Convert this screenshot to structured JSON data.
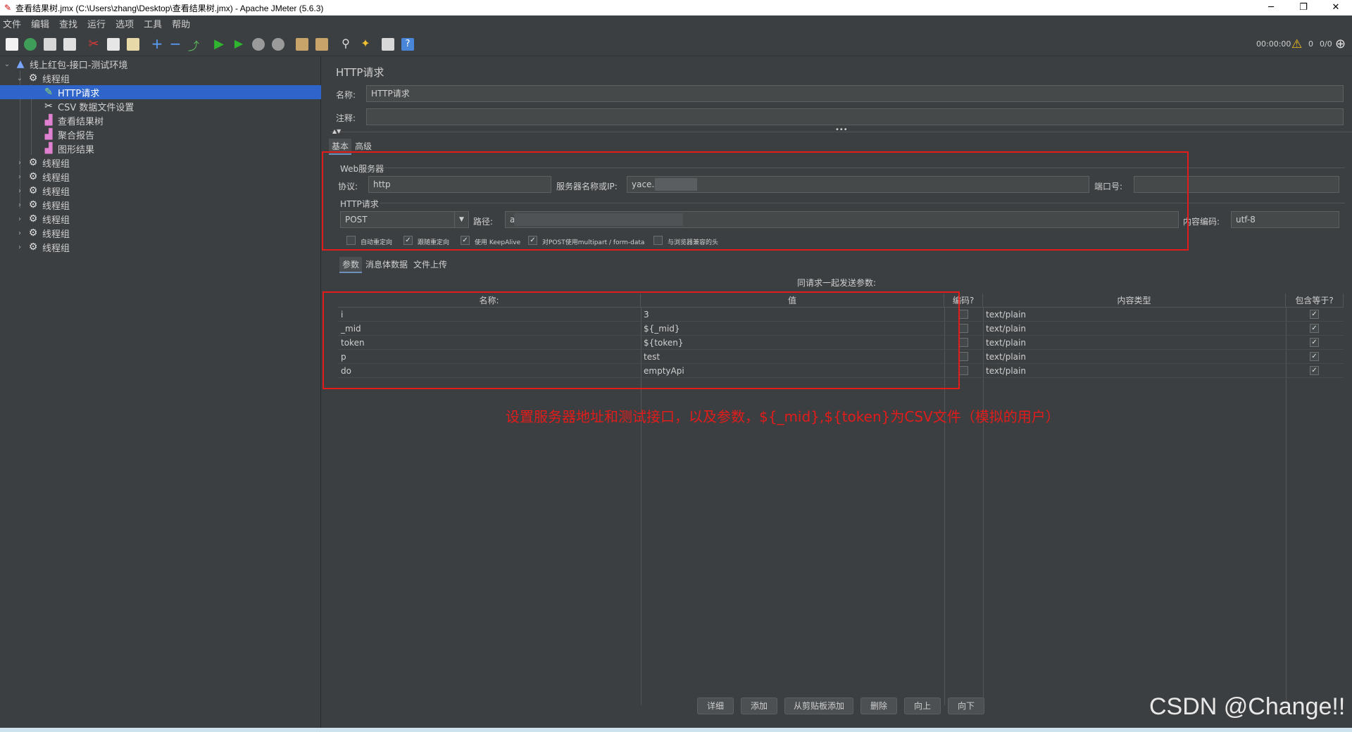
{
  "window": {
    "title": "查看结果树.jmx (C:\\Users\\zhang\\Desktop\\查看结果树.jmx) - Apache JMeter (5.6.3)",
    "minimize": "─",
    "restore": "❐",
    "close": "✕"
  },
  "menu": [
    "文件",
    "编辑",
    "查找",
    "运行",
    "选项",
    "工具",
    "帮助"
  ],
  "status": {
    "timer": "00:00:00",
    "warnings": "0",
    "threads": "0/0"
  },
  "tree": {
    "root": "线上红包-接口-测试环境",
    "group1": "线程组",
    "children": [
      "HTTP请求",
      "CSV 数据文件设置",
      "查看结果树",
      "聚合报告",
      "图形结果"
    ],
    "collapsed_groups": [
      "线程组",
      "线程组",
      "线程组",
      "线程组",
      "线程组",
      "线程组",
      "线程组"
    ]
  },
  "panel": {
    "title": "HTTP请求",
    "name_label": "名称:",
    "name_value": "HTTP请求",
    "comment_label": "注释:",
    "comment_value": "",
    "tabs": [
      "基本",
      "高级"
    ],
    "web_server": {
      "section": "Web服务器",
      "protocol_label": "协议:",
      "protocol_value": "http",
      "server_label": "服务器名称或IP:",
      "server_value": "yace.zl            o.cn",
      "port_label": "端口号:",
      "port_value": ""
    },
    "http_request": {
      "section": "HTTP请求",
      "method": "POST",
      "path_label": "路径:",
      "path_value": "a                                                                                                                  ty.php",
      "encoding_label": "内容编码:",
      "encoding_value": "utf-8"
    },
    "options": [
      {
        "label": "自动重定向",
        "checked": false
      },
      {
        "label": "跟随重定向",
        "checked": true
      },
      {
        "label": "使用 KeepAlive",
        "checked": true
      },
      {
        "label": "对POST使用multipart / form-data",
        "checked": true
      },
      {
        "label": "与浏览器兼容的头",
        "checked": false
      }
    ],
    "subtabs": [
      "参数",
      "消息体数据",
      "文件上传"
    ],
    "params_caption": "同请求一起发送参数:",
    "columns": [
      "名称:",
      "值",
      "编码?",
      "内容类型",
      "包含等于?"
    ],
    "rows": [
      {
        "name": "i",
        "value": "3",
        "content_type": "text/plain"
      },
      {
        "name": "_mid",
        "value": "${_mid}",
        "content_type": "text/plain"
      },
      {
        "name": "token",
        "value": "${token}",
        "content_type": "text/plain"
      },
      {
        "name": "p",
        "value": "test",
        "content_type": "text/plain"
      },
      {
        "name": "do",
        "value": "emptyApi",
        "content_type": "text/plain"
      }
    ],
    "buttons": [
      "详细",
      "添加",
      "从剪贴板添加",
      "删除",
      "向上",
      "向下"
    ]
  },
  "annotation": "设置服务器地址和测试接口，以及参数，${_mid},${token}为CSV文件（模拟的用户）",
  "watermark": "CSDN @Change!!",
  "colors": {
    "selection": "#2f65ca",
    "annotation": "#e21b1b",
    "background": "#3c3f41"
  }
}
